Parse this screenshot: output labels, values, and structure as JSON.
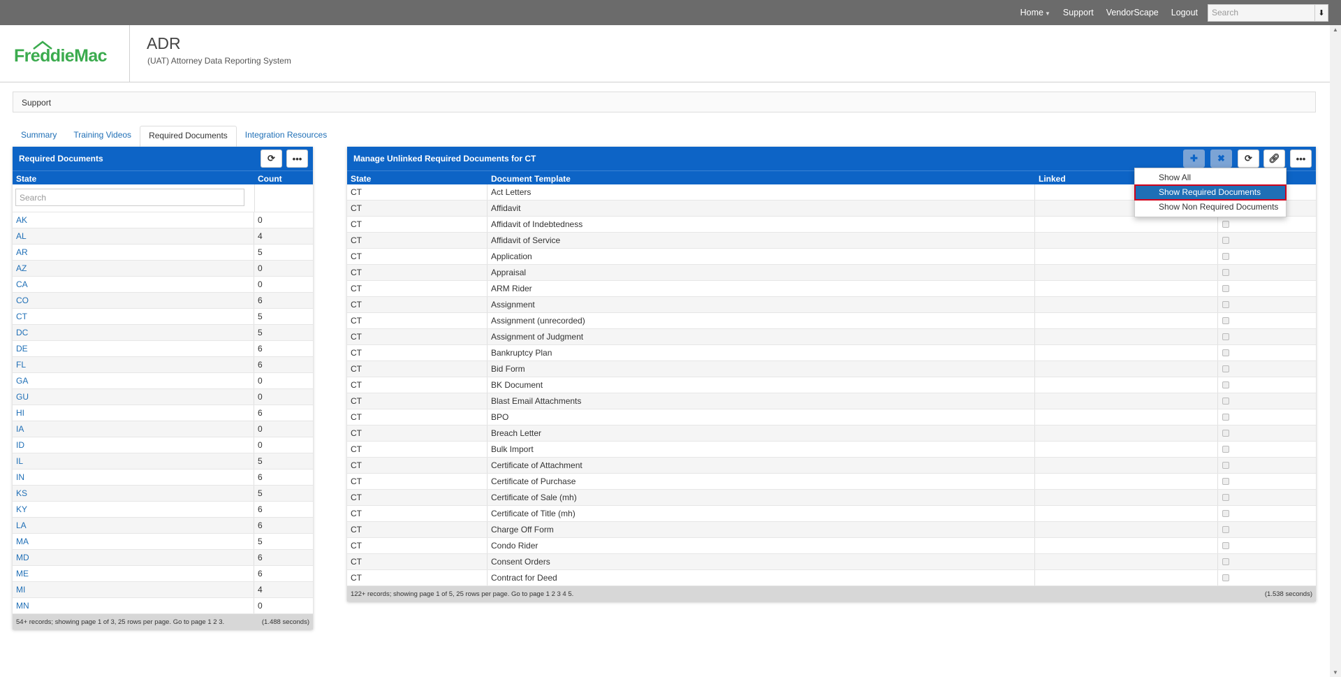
{
  "topnav": {
    "home": "Home",
    "support": "Support",
    "vendorscape": "VendorScape",
    "logout": "Logout",
    "search_placeholder": "Search"
  },
  "header": {
    "logo_text": "FreddieMac",
    "title": "ADR",
    "subtitle": "(UAT) Attorney Data Reporting System"
  },
  "breadcrumb": "Support",
  "tabs": [
    "Summary",
    "Training Videos",
    "Required Documents",
    "Integration Resources"
  ],
  "active_tab": "Required Documents",
  "left_panel": {
    "title": "Required Documents",
    "col_state": "State",
    "col_count": "Count",
    "search_placeholder": "Search",
    "rows": [
      {
        "state": "AK",
        "count": "0"
      },
      {
        "state": "AL",
        "count": "4"
      },
      {
        "state": "AR",
        "count": "5"
      },
      {
        "state": "AZ",
        "count": "0"
      },
      {
        "state": "CA",
        "count": "0"
      },
      {
        "state": "CO",
        "count": "6"
      },
      {
        "state": "CT",
        "count": "5"
      },
      {
        "state": "DC",
        "count": "5"
      },
      {
        "state": "DE",
        "count": "6"
      },
      {
        "state": "FL",
        "count": "6"
      },
      {
        "state": "GA",
        "count": "0"
      },
      {
        "state": "GU",
        "count": "0"
      },
      {
        "state": "HI",
        "count": "6"
      },
      {
        "state": "IA",
        "count": "0"
      },
      {
        "state": "ID",
        "count": "0"
      },
      {
        "state": "IL",
        "count": "5"
      },
      {
        "state": "IN",
        "count": "6"
      },
      {
        "state": "KS",
        "count": "5"
      },
      {
        "state": "KY",
        "count": "6"
      },
      {
        "state": "LA",
        "count": "6"
      },
      {
        "state": "MA",
        "count": "5"
      },
      {
        "state": "MD",
        "count": "6"
      },
      {
        "state": "ME",
        "count": "6"
      },
      {
        "state": "MI",
        "count": "4"
      },
      {
        "state": "MN",
        "count": "0"
      }
    ],
    "footer_left": "54+ records; showing page 1 of 3, 25 rows per page. Go to page 1 2 3.",
    "footer_right": "(1.488 seconds)"
  },
  "right_panel": {
    "title": "Manage Unlinked Required Documents for CT",
    "col_state": "State",
    "col_template": "Document Template",
    "col_linked": "Linked",
    "rows": [
      {
        "state": "CT",
        "template": "Act Letters"
      },
      {
        "state": "CT",
        "template": "Affidavit"
      },
      {
        "state": "CT",
        "template": "Affidavit of Indebtedness"
      },
      {
        "state": "CT",
        "template": "Affidavit of Service"
      },
      {
        "state": "CT",
        "template": "Application"
      },
      {
        "state": "CT",
        "template": "Appraisal"
      },
      {
        "state": "CT",
        "template": "ARM Rider"
      },
      {
        "state": "CT",
        "template": "Assignment"
      },
      {
        "state": "CT",
        "template": "Assignment (unrecorded)"
      },
      {
        "state": "CT",
        "template": "Assignment of Judgment"
      },
      {
        "state": "CT",
        "template": "Bankruptcy Plan"
      },
      {
        "state": "CT",
        "template": "Bid Form"
      },
      {
        "state": "CT",
        "template": "BK Document"
      },
      {
        "state": "CT",
        "template": "Blast Email Attachments"
      },
      {
        "state": "CT",
        "template": "BPO"
      },
      {
        "state": "CT",
        "template": "Breach Letter"
      },
      {
        "state": "CT",
        "template": "Bulk Import"
      },
      {
        "state": "CT",
        "template": "Certificate of Attachment"
      },
      {
        "state": "CT",
        "template": "Certificate of Purchase"
      },
      {
        "state": "CT",
        "template": "Certificate of Sale (mh)"
      },
      {
        "state": "CT",
        "template": "Certificate of Title (mh)"
      },
      {
        "state": "CT",
        "template": "Charge Off Form"
      },
      {
        "state": "CT",
        "template": "Condo Rider"
      },
      {
        "state": "CT",
        "template": "Consent Orders"
      },
      {
        "state": "CT",
        "template": "Contract for Deed"
      }
    ],
    "footer_left": "122+ records; showing page 1 of 5, 25 rows per page. Go to page 1 2 3 4 5.",
    "footer_right": "(1.538 seconds)"
  },
  "menu": {
    "items": [
      "Show All",
      "Show Required Documents",
      "Show Non Required Documents"
    ],
    "selected": "Show Required Documents"
  },
  "colors": {
    "topbar": "#6b6b6b",
    "panel_header": "#0d64c6",
    "link": "#1f6fb6",
    "logo_green": "#3bab4e",
    "highlight_border": "#d0021b"
  }
}
